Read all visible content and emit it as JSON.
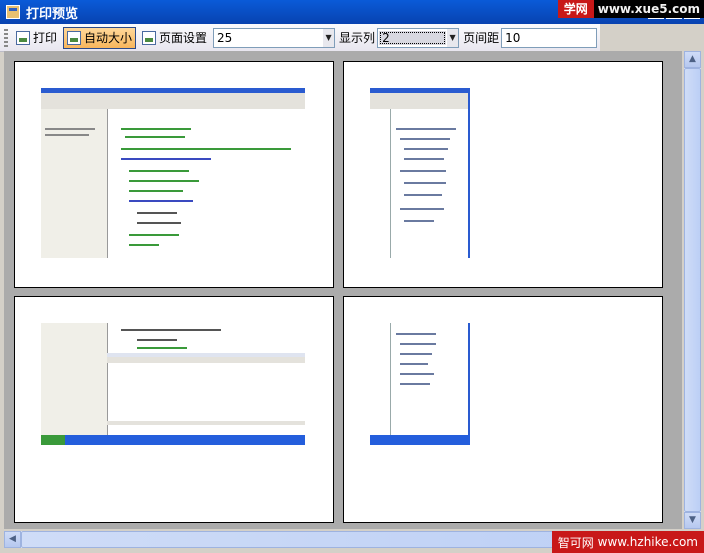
{
  "window": {
    "title": "打印预览"
  },
  "watermark_top": {
    "brand": "学网",
    "url": "www.xue5.com"
  },
  "watermark_bottom": {
    "brand": "智可网",
    "url": "www.hzhike.com"
  },
  "toolbar": {
    "print_label": "打印",
    "autosize_label": "自动大小",
    "page_setup_label": "页面设置",
    "zoom_value": "25",
    "columns_label": "显示列",
    "columns_value": "2",
    "spacing_label": "页间距",
    "spacing_value": "10"
  },
  "icons": {
    "app": "app-icon",
    "print": "print-icon",
    "autosize": "autosize-icon",
    "page_setup": "page-setup-icon"
  },
  "colors": {
    "titlebar": "#0a5bd8",
    "active_button": "#f7b65c",
    "preview_background": "#ababab"
  }
}
